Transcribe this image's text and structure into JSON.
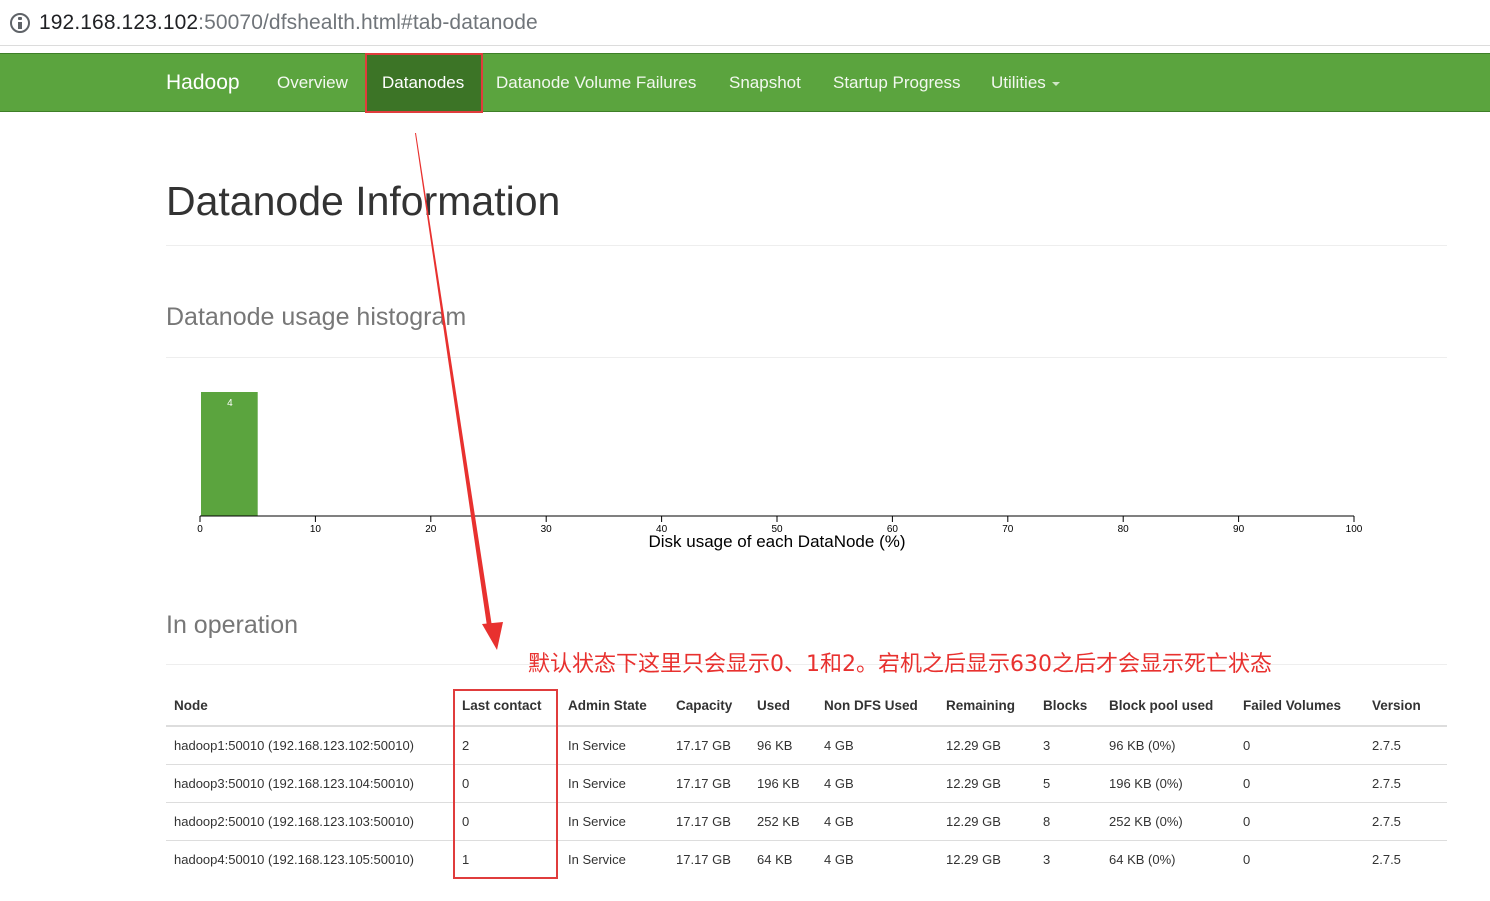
{
  "browser": {
    "url_host": "192.168.123.102",
    "url_rest": ":50070/dfshealth.html#tab-datanode"
  },
  "navbar": {
    "brand": "Hadoop",
    "items": [
      {
        "label": "Overview"
      },
      {
        "label": "Datanodes"
      },
      {
        "label": "Datanode Volume Failures"
      },
      {
        "label": "Snapshot"
      },
      {
        "label": "Startup Progress"
      },
      {
        "label": "Utilities"
      }
    ],
    "active": "Datanodes"
  },
  "page": {
    "title": "Datanode Information",
    "histogram_heading": "Datanode usage histogram",
    "operation_heading": "In operation"
  },
  "chart_data": {
    "type": "bar",
    "bins": [
      [
        0,
        5
      ]
    ],
    "values": [
      4
    ],
    "xlim": [
      0,
      100
    ],
    "xticks": [
      0,
      10,
      20,
      30,
      40,
      50,
      60,
      70,
      80,
      90,
      100
    ],
    "xlabel": "Disk usage of each DataNode (%)",
    "bar_color": "#5ba43e"
  },
  "annotation": {
    "text": "默认状态下这里只会显示0、1和2。宕机之后显示630之后才会显示死亡状态",
    "color": "#e8312f"
  },
  "table": {
    "headers": [
      "Node",
      "Last contact",
      "Admin State",
      "Capacity",
      "Used",
      "Non DFS Used",
      "Remaining",
      "Blocks",
      "Block pool used",
      "Failed Volumes",
      "Version"
    ],
    "rows": [
      [
        "hadoop1:50010 (192.168.123.102:50010)",
        "2",
        "In Service",
        "17.17 GB",
        "96 KB",
        "4 GB",
        "12.29 GB",
        "3",
        "96 KB (0%)",
        "0",
        "2.7.5"
      ],
      [
        "hadoop3:50010 (192.168.123.104:50010)",
        "0",
        "In Service",
        "17.17 GB",
        "196 KB",
        "4 GB",
        "12.29 GB",
        "5",
        "196 KB (0%)",
        "0",
        "2.7.5"
      ],
      [
        "hadoop2:50010 (192.168.123.103:50010)",
        "0",
        "In Service",
        "17.17 GB",
        "252 KB",
        "4 GB",
        "12.29 GB",
        "8",
        "252 KB (0%)",
        "0",
        "2.7.5"
      ],
      [
        "hadoop4:50010 (192.168.123.105:50010)",
        "1",
        "In Service",
        "17.17 GB",
        "64 KB",
        "4 GB",
        "12.29 GB",
        "3",
        "64 KB (0%)",
        "0",
        "2.7.5"
      ]
    ]
  }
}
